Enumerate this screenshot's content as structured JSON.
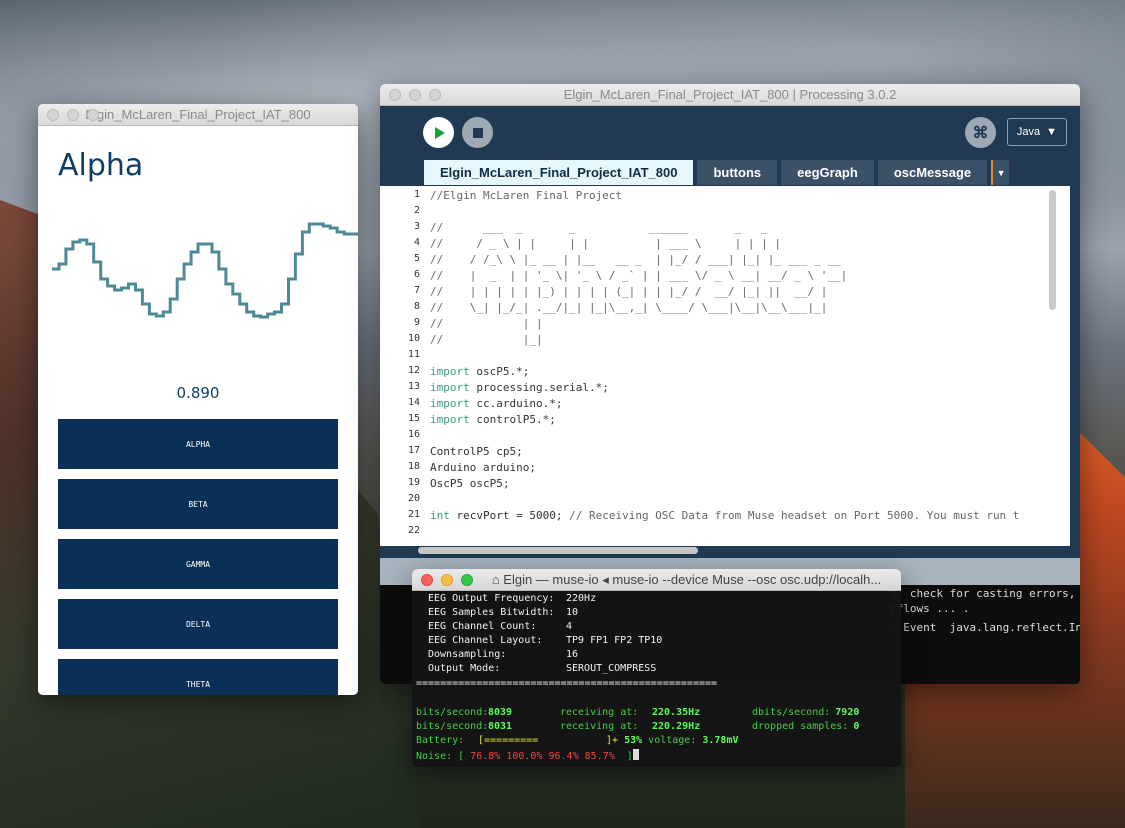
{
  "sketch_window": {
    "title": "Elgin_McLaren_Final_Project_IAT_800",
    "heading": "Alpha",
    "value": "0.890",
    "buttons": [
      "ALPHA",
      "BETA",
      "GAMMA",
      "DELTA",
      "THETA"
    ],
    "button_color": "#0b3057",
    "wave_color": "#4e8a96"
  },
  "ide": {
    "title": "Elgin_McLaren_Final_Project_IAT_800 | Processing 3.0.2",
    "mode": "Java",
    "tabs": [
      "Elgin_McLaren_Final_Project_IAT_800",
      "buttons",
      "eegGraph",
      "oscMessage"
    ],
    "line_numbers": [
      "1",
      "2",
      "3",
      "4",
      "5",
      "6",
      "7",
      "8",
      "9",
      "10",
      "11",
      "12",
      "13",
      "14",
      "15",
      "16",
      "17",
      "18",
      "19",
      "20",
      "21",
      "22"
    ],
    "code_lines": [
      "//Elgin McLaren Final Project",
      "",
      "//      ___  _       _           ______       _   _",
      "//     / _ \\ | |     | |          | ___ \\     | | | |",
      "//    / /_\\ \\ |_ __ | |__   __ _  | |_/ / ___| |_| |_ ___ _ __",
      "//    |  _  | | '_ \\| '_ \\ / _` | | ___ \\/ _ \\ __| __/ _ \\ '__|",
      "//    | | | | | |_) | | | | (_| | | |_/ /  __/ |_| ||  __/ |",
      "//    \\_| |_/_| .__/|_| |_|\\__,_| \\____/ \\___|\\__|\\__\\___|_|",
      "//            | |",
      "//            |_|",
      "",
      "import oscP5.*;",
      "import processing.serial.*;",
      "import cc.arduino.*;",
      "import controlP5.*;",
      "",
      "ControlP5 cp5;",
      "Arduino arduino;",
      "OscP5 oscP5;",
      "",
      "int recvPort = 5000; // Receiving OSC Data from Muse headset on Port 5000. You must run t",
      ""
    ],
    "console": [
      "g. check for casting errors, possible",
      "rflows ... .",
      ". Event  java.lang.reflect.InvocationTargetException"
    ]
  },
  "terminal": {
    "title": "Elgin — muse-io ◂ muse-io --device Muse --osc osc.udp://localh...",
    "config": [
      {
        "label": "EEG Output Frequency:",
        "value": "220Hz"
      },
      {
        "label": "EEG Samples Bitwidth:",
        "value": "10"
      },
      {
        "label": "EEG Channel Count:",
        "value": "4"
      },
      {
        "label": "EEG Channel Layout:",
        "value": "TP9 FP1 FP2 TP10"
      },
      {
        "label": "Downsampling:",
        "value": "16"
      },
      {
        "label": "Output Mode:",
        "value": "SEROUT_COMPRESS"
      }
    ],
    "separator": "==================================================",
    "stats": [
      {
        "bits_label": "bits/second:",
        "bits": "8039",
        "recv_label": "receiving at:",
        "recv": "220.35Hz",
        "extra_label": "dbits/second:",
        "extra": "7920"
      },
      {
        "bits_label": "bits/second:",
        "bits": "8031",
        "recv_label": "receiving at:",
        "recv": "220.29Hz",
        "extra_label": "dropped samples:",
        "extra": "0"
      }
    ],
    "battery_label": "Battery:",
    "battery_bar": "[=========",
    "battery_bar_end": "]+",
    "battery_pct": "53%",
    "voltage_label": "voltage:",
    "voltage": "3.78mV",
    "battery_level": 0.53,
    "noise_label": "Noise: [",
    "noise_values": [
      "76.8%",
      "100.0%",
      "96.4%",
      "85.7%"
    ],
    "noise_end": "]"
  },
  "wave_values": [
    0.55,
    0.6,
    0.75,
    0.82,
    0.84,
    0.8,
    0.62,
    0.45,
    0.38,
    0.34,
    0.36,
    0.4,
    0.34,
    0.2,
    0.1,
    0.08,
    0.12,
    0.25,
    0.45,
    0.6,
    0.72,
    0.8,
    0.8,
    0.72,
    0.55,
    0.4,
    0.3,
    0.2,
    0.12,
    0.08,
    0.07,
    0.1,
    0.12,
    0.2,
    0.45,
    0.7,
    0.92,
    1.0,
    1.0,
    0.98,
    0.96,
    0.92,
    0.9,
    0.9,
    0.9
  ]
}
